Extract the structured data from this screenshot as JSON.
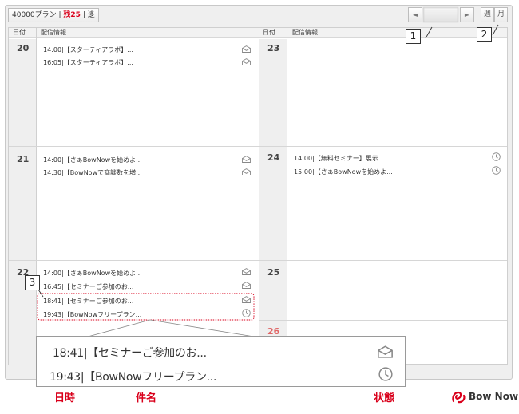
{
  "toolbar": {
    "plan_label": "40000プラン",
    "remaining_label": "残25",
    "other_label": "迻",
    "prev_glyph": "◄",
    "next_glyph": "►",
    "week_label": "週",
    "month_label": "月"
  },
  "headers": {
    "date": "日付",
    "info": "配信情報"
  },
  "days": [
    {
      "num": "20",
      "entries": [
        {
          "time": "14:00",
          "title": "【スターティアラボ】..."
        },
        {
          "time": "16:05",
          "title": "【スターティアラボ】..."
        }
      ]
    },
    {
      "num": "23",
      "entries": []
    },
    {
      "num": "21",
      "entries": [
        {
          "time": "14:00",
          "title": "【さぁBowNowを始めよ..."
        },
        {
          "time": "14:30",
          "title": "【BowNowで商談数を増..."
        }
      ]
    },
    {
      "num": "24",
      "entries": [
        {
          "time": "14:00",
          "title": "【無料セミナー】展示..."
        },
        {
          "time": "15:00",
          "title": "【さぁBowNowを始めよ..."
        }
      ]
    },
    {
      "num": "22",
      "entries": [
        {
          "time": "14:00",
          "title": "【さぁBowNowを始めよ..."
        },
        {
          "time": "16:45",
          "title": "【セミナーご参加のお..."
        },
        {
          "time": "18:41",
          "title": "【セミナーご参加のお..."
        },
        {
          "time": "19:43",
          "title": "【BowNowフリープラン..."
        }
      ]
    },
    {
      "num": "25",
      "entries": []
    },
    {
      "num": "26",
      "entries": []
    }
  ],
  "zoom": [
    {
      "time": "18:41",
      "title": "【セミナーご参加のお..."
    },
    {
      "time": "19:43",
      "title": "【BowNowフリープラン..."
    }
  ],
  "callouts": [
    "1",
    "2",
    "3"
  ],
  "legend": {
    "datetime": "日時",
    "subject": "件名",
    "status": "状態"
  },
  "brand": {
    "name": "Bow Now",
    "icon": "bownow-logo-icon",
    "color": "#d9001b"
  },
  "icons": {
    "sent": "envelope-open-icon",
    "scheduled": "clock-icon"
  }
}
